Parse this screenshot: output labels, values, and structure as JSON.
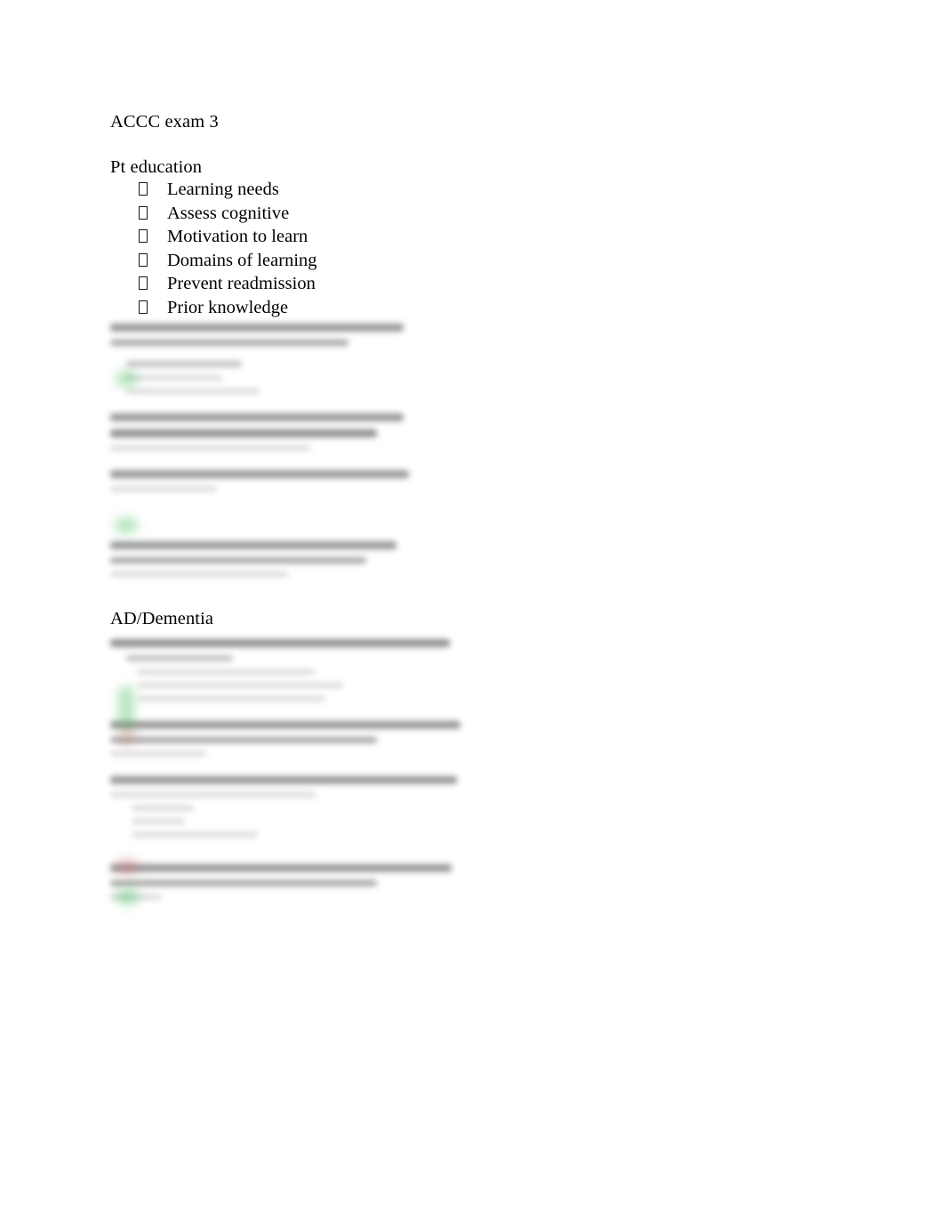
{
  "document": {
    "title": "ACCC exam 3",
    "page_background": "#ffffff",
    "text_color": "#000000"
  },
  "sections": [
    {
      "heading": "Pt education",
      "bullets": [
        "Learning needs",
        "Assess cognitive",
        "Motivation to learn",
        "Domains of learning",
        "Prevent readmission",
        "Prior knowledge"
      ]
    },
    {
      "heading": "AD/Dementia",
      "bullets": []
    }
  ],
  "redacted": {
    "note": "Body text below each heading is blurred and illegible in the source image.",
    "blocks": [
      {
        "id": "block-1",
        "after_heading": "Pt education"
      },
      {
        "id": "block-2",
        "after_heading": "Pt education"
      },
      {
        "id": "block-3",
        "after_heading": "Pt education"
      },
      {
        "id": "block-4",
        "after_heading": "Pt education"
      },
      {
        "id": "block-5",
        "after_heading": "AD/Dementia"
      },
      {
        "id": "block-6",
        "after_heading": "AD/Dementia"
      },
      {
        "id": "block-7",
        "after_heading": "AD/Dementia"
      },
      {
        "id": "block-8",
        "after_heading": "AD/Dementia"
      }
    ]
  },
  "highlights": {
    "green": "#43c15a",
    "pink": "#cf5a5a",
    "marks": [
      {
        "color": "green",
        "shape": "blob"
      },
      {
        "color": "green",
        "shape": "blob"
      },
      {
        "color": "green",
        "shape": "bar"
      },
      {
        "color": "pink",
        "shape": "bar"
      },
      {
        "color": "pink",
        "shape": "blob"
      },
      {
        "color": "green",
        "shape": "blob"
      }
    ]
  },
  "icons": {
    "bullet": "missing-glyph-box"
  }
}
